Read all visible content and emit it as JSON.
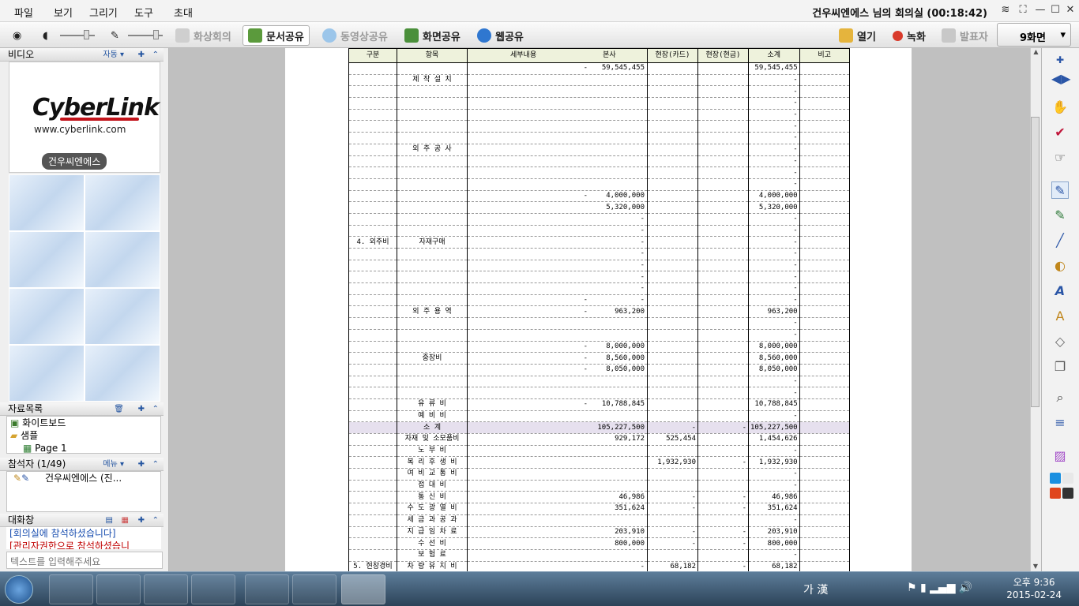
{
  "menu": {
    "items": [
      "파일",
      "보기",
      "그리기",
      "도구",
      "초대"
    ],
    "title": "건우씨엔에스 님의 회의실 (00:18:42)"
  },
  "toolbar": {
    "video_conf": "화상회의",
    "doc_share": "문서공유",
    "video_share": "동영상공유",
    "screen_share": "화면공유",
    "web_share": "웹공유",
    "open": "열기",
    "record": "녹화",
    "presenter": "발표자",
    "screen_layout": "9화면"
  },
  "video_panel": {
    "title": "비디오",
    "mode": "자동 ▾",
    "logo": "CyberLink",
    "logo_url": "www.cyberlink.com",
    "name_tag": "건우씨엔에스"
  },
  "materials": {
    "title": "자료목록",
    "items": [
      "화이트보드",
      "샘플",
      "Page 1"
    ]
  },
  "participants": {
    "title": "참석자 (1/49)",
    "menu": "메뉴 ▾",
    "name": "건우씨엔에스 (진..."
  },
  "chat": {
    "title": "대화창",
    "messages": [
      "[회의실에 참석하셨습니다]",
      "[관리자권한으로 참석하셨습니"
    ],
    "placeholder": "텍스트를 입력해주세요"
  },
  "sheet": {
    "headers": [
      "구분",
      "항목",
      "세부내용",
      "본사",
      "현장(카드)",
      "현장(현금)",
      "소계",
      "비고"
    ],
    "rows": [
      [
        "",
        "",
        "",
        "-",
        "59,545,455",
        "",
        "",
        "59,545,455",
        ""
      ],
      [
        "",
        "제 작 설 치",
        "",
        "",
        "",
        "",
        "",
        "-",
        ""
      ],
      [
        "",
        "",
        "",
        "",
        "",
        "",
        "",
        "-",
        ""
      ],
      [
        "",
        "",
        "",
        "",
        "",
        "",
        "",
        "-",
        ""
      ],
      [
        "",
        "",
        "",
        "",
        "",
        "",
        "",
        "-",
        ""
      ],
      [
        "",
        "",
        "",
        "",
        "",
        "",
        "",
        "-",
        ""
      ],
      [
        "",
        "",
        "",
        "",
        "",
        "",
        "",
        "-",
        ""
      ],
      [
        "",
        "외 주 공 사",
        "",
        "",
        "",
        "",
        "",
        "-",
        ""
      ],
      [
        "",
        "",
        "",
        "",
        "",
        "",
        "",
        "-",
        ""
      ],
      [
        "",
        "",
        "",
        "",
        "",
        "",
        "",
        "-",
        ""
      ],
      [
        "",
        "",
        "",
        "",
        "",
        "",
        "",
        "-",
        ""
      ],
      [
        "",
        "",
        "",
        "-",
        "4,000,000",
        "",
        "",
        "4,000,000",
        ""
      ],
      [
        "",
        "",
        "",
        "",
        "5,320,000",
        "",
        "",
        "5,320,000",
        ""
      ],
      [
        "",
        "",
        "",
        "",
        "-",
        "",
        "",
        "-",
        ""
      ],
      [
        "",
        "",
        "",
        "",
        "-",
        "",
        "",
        "-",
        ""
      ],
      [
        "4. 외주비",
        "자재구매",
        "",
        "",
        "-",
        "",
        "",
        "-",
        ""
      ],
      [
        "",
        "",
        "",
        "",
        "-",
        "",
        "",
        "-",
        ""
      ],
      [
        "",
        "",
        "",
        "",
        "-",
        "",
        "",
        "-",
        ""
      ],
      [
        "",
        "",
        "",
        "",
        "-",
        "",
        "",
        "-",
        ""
      ],
      [
        "",
        "",
        "",
        "",
        "-",
        "",
        "",
        "-",
        ""
      ],
      [
        "",
        "",
        "",
        "-",
        "-",
        "",
        "",
        "-",
        ""
      ],
      [
        "",
        "외 주 용 역",
        "",
        "-",
        "963,200",
        "",
        "",
        "963,200",
        ""
      ],
      [
        "",
        "",
        "",
        "",
        "",
        "",
        "",
        "-",
        ""
      ],
      [
        "",
        "",
        "",
        "",
        "",
        "",
        "",
        "-",
        ""
      ],
      [
        "",
        "",
        "",
        "-",
        "8,000,000",
        "",
        "",
        "8,000,000",
        ""
      ],
      [
        "",
        "중장비",
        "",
        "-",
        "8,560,000",
        "",
        "",
        "8,560,000",
        ""
      ],
      [
        "",
        "",
        "",
        "-",
        "8,050,000",
        "",
        "",
        "8,050,000",
        ""
      ],
      [
        "",
        "",
        "",
        "",
        "",
        "",
        "",
        "-",
        ""
      ],
      [
        "",
        "",
        "",
        "",
        "",
        "",
        "",
        "-",
        ""
      ],
      [
        "",
        "유 류 비",
        "",
        "-",
        "10,788,845",
        "",
        "",
        "10,788,845",
        ""
      ],
      [
        "",
        "예 비 비",
        "",
        "",
        "",
        "",
        "",
        "-",
        ""
      ],
      [
        "",
        "소 계",
        "",
        "",
        "105,227,500",
        "-",
        "-",
        "105,227,500",
        ""
      ],
      [
        "",
        "자재 및 소모품비",
        "",
        "",
        "929,172",
        "525,454",
        "",
        "1,454,626",
        ""
      ],
      [
        "",
        "노 무 비",
        "",
        "",
        "",
        "",
        "",
        "-",
        ""
      ],
      [
        "",
        "복 리 후 생 비",
        "",
        "",
        "",
        "1,932,930",
        "-",
        "1,932,930",
        ""
      ],
      [
        "",
        "여 비 교 통 비",
        "",
        "",
        "",
        "",
        "",
        "-",
        ""
      ],
      [
        "",
        "접 대 비",
        "",
        "",
        "",
        "",
        "",
        "-",
        ""
      ],
      [
        "",
        "통 신 비",
        "",
        "",
        "46,986",
        "-",
        "-",
        "46,986",
        ""
      ],
      [
        "",
        "수 도 광 열 비",
        "",
        "",
        "351,624",
        "-",
        "-",
        "351,624",
        ""
      ],
      [
        "",
        "세 금 과 공 과",
        "",
        "",
        "",
        "",
        "",
        "-",
        ""
      ],
      [
        "",
        "지 급 임 차 료",
        "",
        "",
        "203,910",
        "-",
        "-",
        "203,910",
        ""
      ],
      [
        "",
        "수 선 비",
        "",
        "",
        "800,000",
        "-",
        "-",
        "800,000",
        ""
      ],
      [
        "",
        "보 험 료",
        "",
        "",
        "",
        "",
        "",
        "-",
        ""
      ],
      [
        "5. 현장경비",
        "차 량 유 지 비",
        "",
        "",
        "-",
        "68,182",
        "-",
        "68,182",
        ""
      ]
    ]
  },
  "taskbar": {
    "ime": "가 漢",
    "time": "오후 9:36",
    "date": "2015-02-24"
  }
}
